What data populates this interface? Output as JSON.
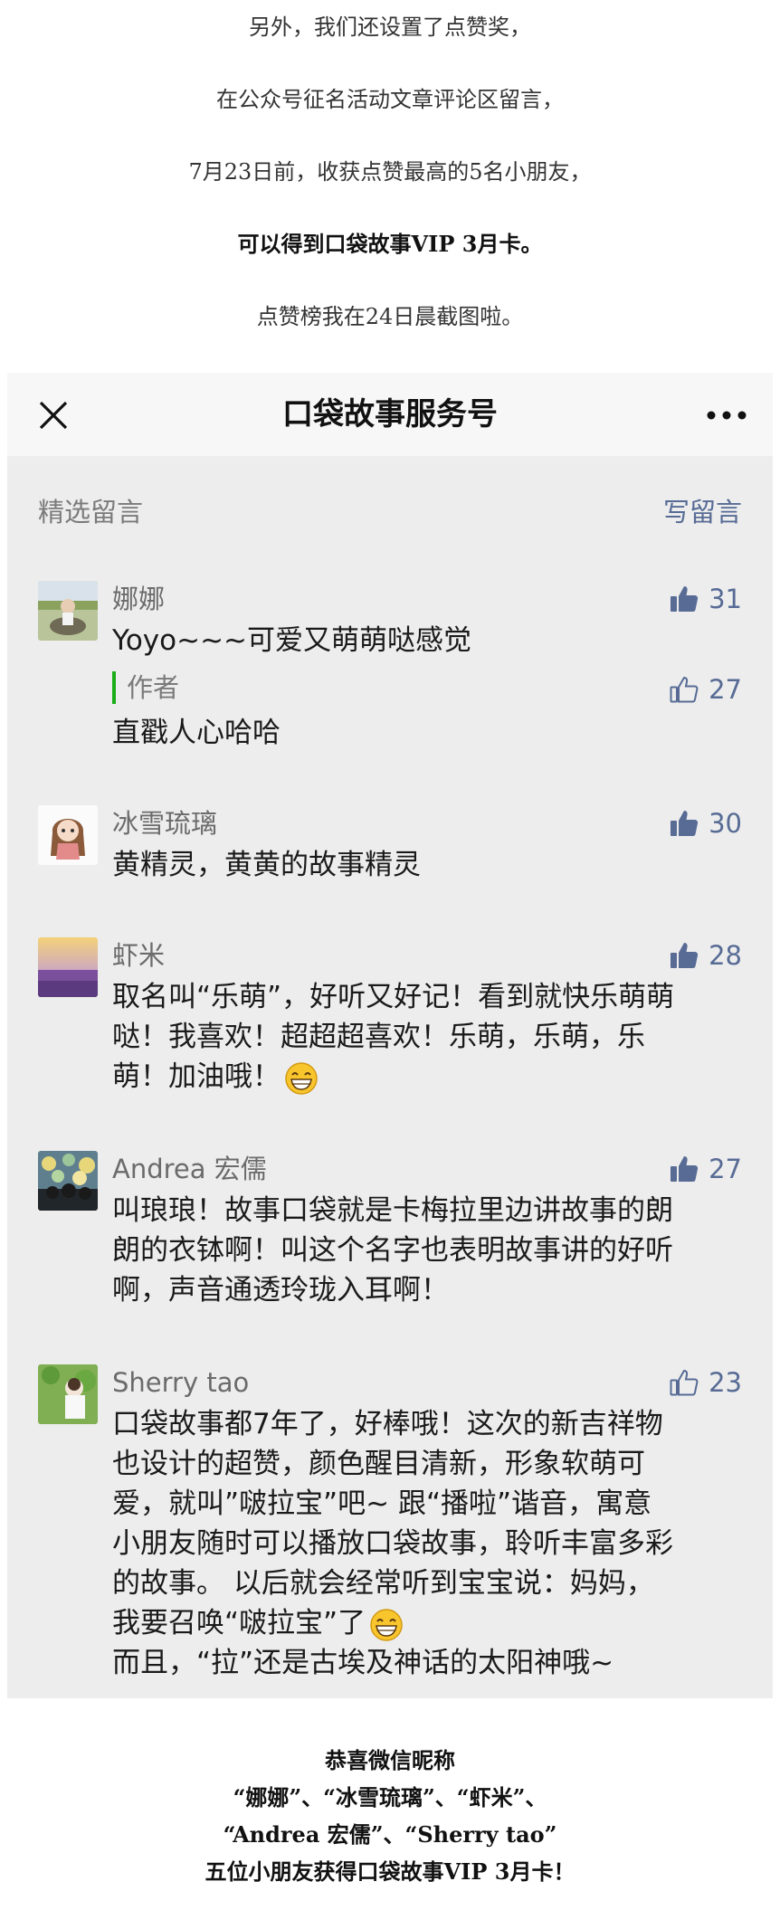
{
  "article_top": {
    "line1": "另外，我们还设置了点赞奖，",
    "line2": "在公众号征名活动文章评论区留言，",
    "line3": "7月23日前，收获点赞最高的5名小朋友，",
    "line4": "可以得到口袋故事VIP 3月卡。",
    "line5": "点赞榜我在24日晨截图啦。"
  },
  "navbar": {
    "title": "口袋故事服务号"
  },
  "comments_header": {
    "section_label": "精选留言",
    "write_label": "写留言"
  },
  "comments": [
    {
      "nickname": "娜娜",
      "text": "Yoyo~~~可爱又萌萌哒感觉",
      "likes": "31",
      "liked": true,
      "author_label": "作者",
      "reply_text": "直戳人心哈哈",
      "reply_likes": "27"
    },
    {
      "nickname": "冰雪琉璃",
      "text": "黄精灵，黄黄的故事精灵",
      "likes": "30",
      "liked": true
    },
    {
      "nickname": "虾米",
      "text_lines": [
        "取名叫“乐萌”，好听又好记！看到就快乐萌萌",
        "哒！我喜欢！超超超喜欢！乐萌，乐萌，乐",
        "萌！加油哦！"
      ],
      "likes": "28",
      "liked": true
    },
    {
      "nickname": "Andrea 宏儒",
      "text_lines": [
        "叫琅琅！故事口袋就是卡梅拉里边讲故事的朗",
        "朗的衣钵啊！叫这个名字也表明故事讲的好听",
        "啊，声音通透玲珑入耳啊！"
      ],
      "likes": "27",
      "liked": true
    },
    {
      "nickname": "Sherry tao",
      "text_lines": [
        "口袋故事都7年了，好棒哦！这次的新吉祥物",
        "也设计的超赞，颜色醒目清新，形象软萌可",
        "爱，就叫”啵拉宝”吧~ 跟“播啦”谐音，寓意",
        "小朋友随时可以播放口袋故事，聆听丰富多彩",
        "的故事。 以后就会经常听到宝宝说：妈妈，",
        "我要召唤“啵拉宝”了",
        "而且，“拉”还是古埃及神话的太阳神哦~"
      ],
      "likes": "23",
      "liked": false
    }
  ],
  "article_bottom": {
    "line1": "恭喜微信昵称",
    "line2": "“娜娜”、“冰雪琉璃”、“虾米”、",
    "line3": "“Andrea 宏儒”、“Sherry tao”",
    "line4": "五位小朋友获得口袋故事VIP 3月卡！"
  },
  "colors": {
    "link_blue": "#576b95",
    "author_green": "#1aad19",
    "panel_bg": "#ededed"
  }
}
